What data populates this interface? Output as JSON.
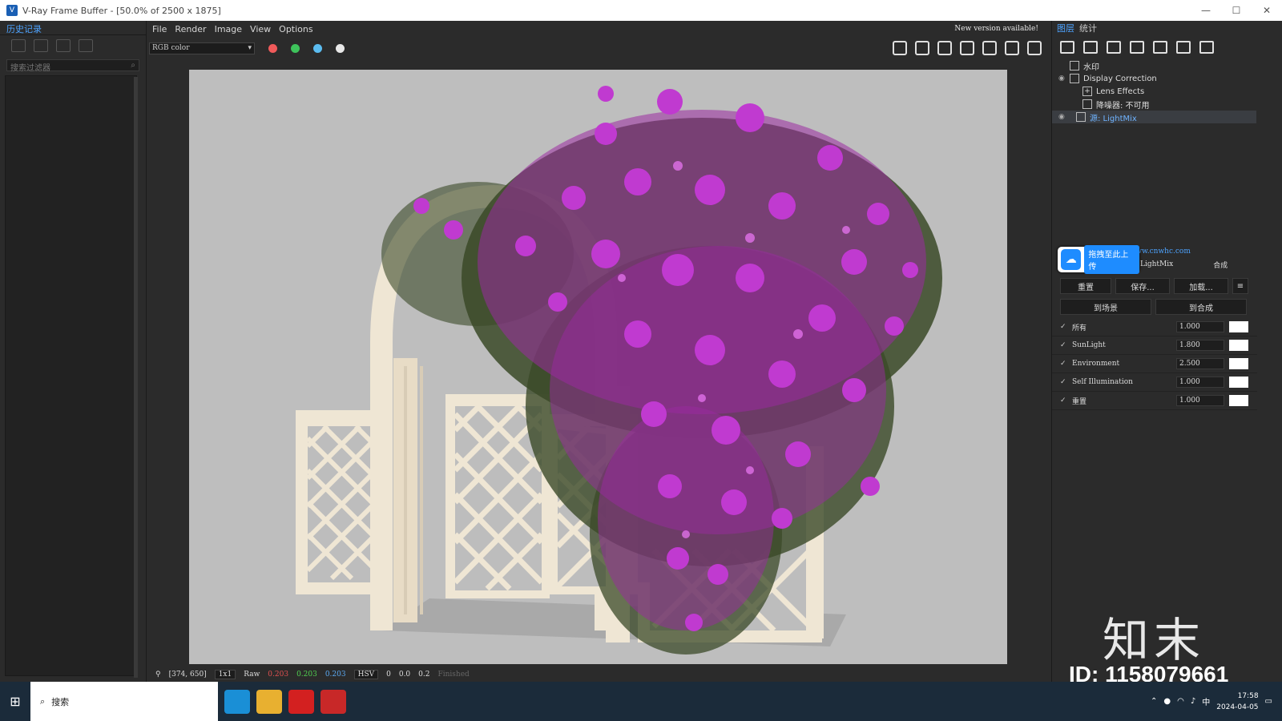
{
  "window": {
    "title": "V-Ray Frame Buffer - [50.0% of 2500 x 1875]",
    "icon": "vray-icon"
  },
  "left_panel": {
    "tab_label": "历史记录",
    "search_placeholder": "搜索过滤器"
  },
  "menubar": {
    "items": [
      "File",
      "Render",
      "Image",
      "View",
      "Options"
    ],
    "new_version": "New version available!"
  },
  "toolbar": {
    "channel": "RGB color",
    "dot_colors": [
      "#f05a5a",
      "#3ec35b",
      "#5bbcf0"
    ]
  },
  "statusbar": {
    "coords": "[374, 650]",
    "zoom": "1x1",
    "raw_label": "Raw",
    "r": "0.203",
    "g": "0.203",
    "b": "0.203",
    "colorspace": "HSV",
    "h": "0",
    "s": "0.0",
    "v": "0.2",
    "status": "Finished"
  },
  "right_panel": {
    "tabs": [
      "图层",
      "统计"
    ],
    "layers": [
      {
        "label": "水印",
        "eye": false
      },
      {
        "label": "Display Correction",
        "eye": true
      },
      {
        "label": "Lens Effects",
        "eye": false
      },
      {
        "label": "降噪器: 不可用",
        "eye": false
      },
      {
        "label": "源: LightMix",
        "eye": true
      }
    ],
    "props_header": "属性  莫图库图层汉化  www.cnwhc.com",
    "mode_lightmix": "LightMix",
    "mode_composite": "合成",
    "buttons": {
      "reset": "重置",
      "save": "保存...",
      "load": "加载...",
      "to_scene": "到场景",
      "to_composite": "到合成"
    },
    "lights": [
      {
        "name": "所有",
        "value": "1.000"
      },
      {
        "name": "SunLight",
        "value": "1.800"
      },
      {
        "name": "Environment",
        "value": "2.500"
      },
      {
        "name": "Self Illumination",
        "value": "1.000"
      },
      {
        "name": "重置",
        "value": "1.000"
      }
    ],
    "upload_text": "拖拽至此上传"
  },
  "watermark": {
    "brand": "知末",
    "id": "ID: 1158079661"
  },
  "taskbar": {
    "search": "搜索",
    "ime": "中",
    "time": "17:58",
    "date": "2024-04-05"
  }
}
